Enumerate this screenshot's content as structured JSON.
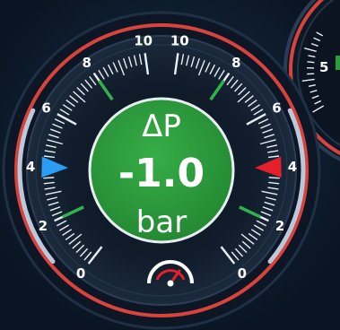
{
  "gauge": {
    "title": "ΔP",
    "value": "-1.0",
    "unit": "bar",
    "left_scale": {
      "labels": [
        "0",
        "2",
        "4",
        "6",
        "8",
        "10"
      ],
      "min": 0,
      "max": 10,
      "indicator_value": 4,
      "indicator_color": "#2a9df4"
    },
    "right_scale": {
      "labels": [
        "0",
        "2",
        "4",
        "6",
        "8",
        "10"
      ],
      "min": 0,
      "max": 10,
      "indicator_value": 4,
      "indicator_color": "#e5202b"
    },
    "green_marks": [
      2,
      8
    ],
    "center_color": "#2d9a3c",
    "ring_color": "#d8433b",
    "footer_icon": "speedometer-icon"
  },
  "neighbor_gauge": {
    "visible_label": "5"
  }
}
